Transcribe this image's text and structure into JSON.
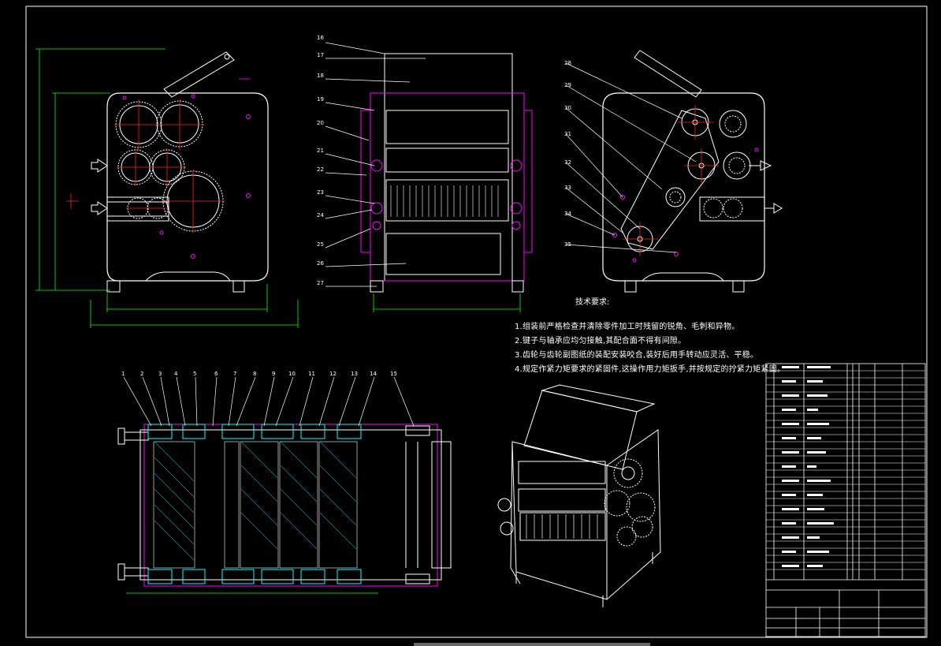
{
  "views": {
    "front": {
      "name": "front-view"
    },
    "side": {
      "name": "side-view"
    },
    "rear": {
      "name": "rear-view"
    },
    "section": {
      "name": "section-view"
    },
    "iso": {
      "name": "isometric-view"
    }
  },
  "callouts_side": [
    "16",
    "17",
    "18",
    "19",
    "20",
    "21",
    "22",
    "23",
    "24",
    "25",
    "26",
    "27"
  ],
  "callouts_rear": [
    "28",
    "29",
    "30",
    "31",
    "32",
    "33",
    "34",
    "35"
  ],
  "callouts_section": [
    "1",
    "2",
    "3",
    "4",
    "5",
    "6",
    "7",
    "8",
    "9",
    "10",
    "11",
    "12",
    "13",
    "14",
    "15"
  ],
  "technical_requirements": {
    "title": "技术要求:",
    "items": [
      "1.组装前严格检查并清除零件加工时残留的锐角、毛刺和异物。",
      "2.键子与轴承应均匀接触,其配合面不得有间隙。",
      "3.齿轮与齿轮副图纸的装配安装咬合,装好后用手转动应灵活、平稳。",
      "4.规定作紧力矩要求的紧固件,这操作用力矩扳手,并按规定的拧紧力矩紧固。"
    ]
  },
  "colors": {
    "background": "#000000",
    "outline": "#ffffff",
    "magenta": "#ff00ff",
    "red": "#ff2020",
    "green": "#00ff00",
    "cyan": "#00ffff",
    "frame": "#ffffff"
  }
}
